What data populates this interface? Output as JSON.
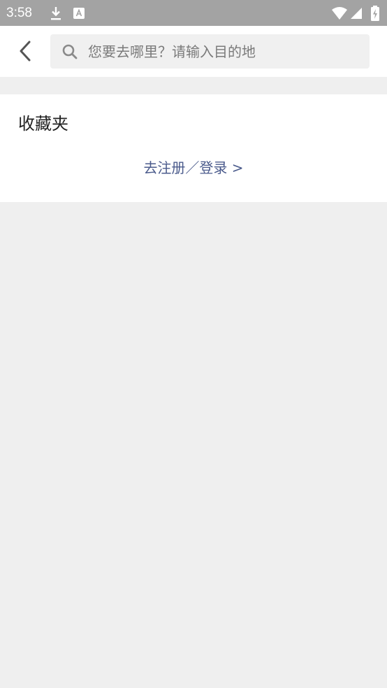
{
  "status_bar": {
    "time": "3:58",
    "icons": [
      "download-icon",
      "keyboard-a-icon",
      "wifi-icon",
      "signal-icon",
      "battery-icon"
    ]
  },
  "header": {
    "search": {
      "placeholder": "您要去哪里？请输入目的地",
      "value": ""
    }
  },
  "favorites": {
    "title": "收藏夹",
    "login_link": "去注册／登录 >"
  },
  "colors": {
    "status_bar_bg": "#a3a3a3",
    "page_bg": "#efefef",
    "search_bg": "#f0f0f0",
    "link_color": "#4b5b8c"
  }
}
